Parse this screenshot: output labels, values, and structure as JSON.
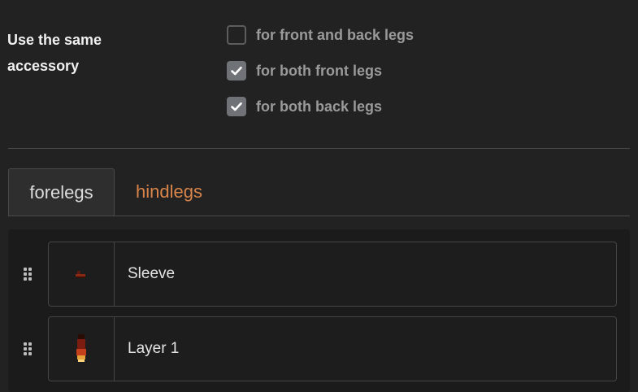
{
  "accessory": {
    "label": "Use the same accessory",
    "options": [
      {
        "label": "for front and back legs",
        "checked": false
      },
      {
        "label": "for both front legs",
        "checked": true
      },
      {
        "label": "for both back legs",
        "checked": true
      }
    ]
  },
  "tabs": [
    {
      "label": "forelegs",
      "active": true
    },
    {
      "label": "hindlegs",
      "active": false,
      "color": "#d9844a"
    }
  ],
  "layers": [
    {
      "name": "Sleeve",
      "icon": "sleeve-thumbnail"
    },
    {
      "name": "Layer 1",
      "icon": "layer-thumbnail"
    }
  ]
}
